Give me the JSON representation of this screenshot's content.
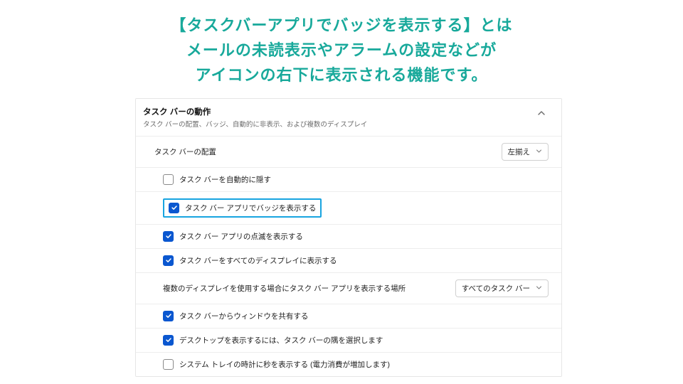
{
  "caption": {
    "line1": "【タスクバーアプリでバッジを表示する】とは",
    "line2": "メールの未読表示やアラームの設定などが",
    "line3": "アイコンの右下に表示される機能です。"
  },
  "panel": {
    "title": "タスク バーの動作",
    "subtitle": "タスク バーの配置、バッジ、自動的に非表示、および複数のディスプレイ"
  },
  "rows": {
    "alignment": {
      "label": "タスク バーの配置",
      "select_value": "左揃え"
    },
    "auto_hide": {
      "label": "タスク バーを自動的に隠す",
      "checked": false
    },
    "badges": {
      "label": "タスク バー アプリでバッジを表示する",
      "checked": true
    },
    "flashing": {
      "label": "タスク バー アプリの点滅を表示する",
      "checked": true
    },
    "all_displays": {
      "label": "タスク バーをすべてのディスプレイに表示する",
      "checked": true
    },
    "multi_where": {
      "label": "複数のディスプレイを使用する場合にタスク バー アプリを表示する場所",
      "select_value": "すべてのタスク バー"
    },
    "share_window": {
      "label": "タスク バーからウィンドウを共有する",
      "checked": true
    },
    "show_desktop": {
      "label": "デスクトップを表示するには、タスク バーの隅を選択します",
      "checked": true
    },
    "seconds": {
      "label": "システム トレイの時計に秒を表示する (電力消費が増加します)",
      "checked": false
    }
  }
}
